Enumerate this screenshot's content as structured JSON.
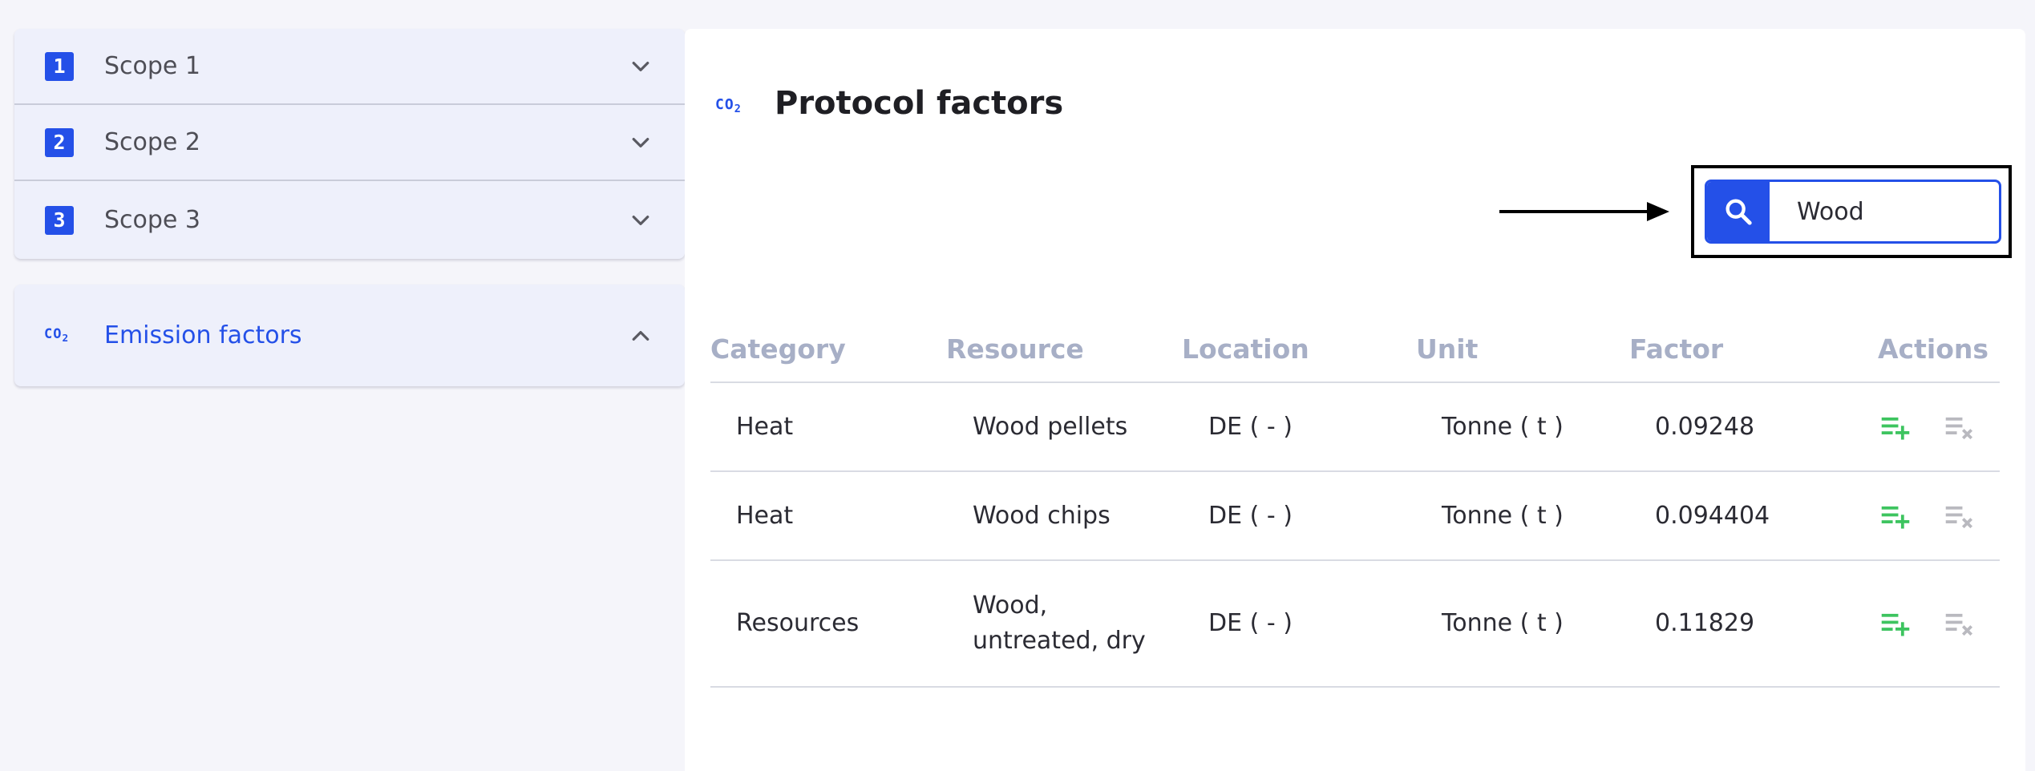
{
  "sidebar": {
    "scopes": [
      {
        "badge": "1",
        "label": "Scope 1"
      },
      {
        "badge": "2",
        "label": "Scope 2"
      },
      {
        "badge": "3",
        "label": "Scope 3"
      }
    ],
    "emission": {
      "icon_text": "CO",
      "icon_sub": "2",
      "label": "Emission factors"
    }
  },
  "main": {
    "icon_text": "CO",
    "icon_sub": "2",
    "title": "Protocol factors",
    "search": {
      "value": "Wood"
    }
  },
  "table": {
    "headers": [
      "Category",
      "Resource",
      "Location",
      "Unit",
      "Factor",
      "Actions"
    ],
    "rows": [
      {
        "category": "Heat",
        "resource": "Wood pellets",
        "location": "DE ( - )",
        "unit": "Tonne ( t )",
        "factor": "0.09248"
      },
      {
        "category": "Heat",
        "resource": "Wood chips",
        "location": "DE ( - )",
        "unit": "Tonne ( t )",
        "factor": "0.094404"
      },
      {
        "category": "Resources",
        "resource_line1": "Wood,",
        "resource_line2": "untreated, dry",
        "location": "DE ( - )",
        "unit": "Tonne ( t )",
        "factor": "0.11829"
      }
    ]
  },
  "colors": {
    "accent": "#2450e8",
    "add": "#3dc45f",
    "remove": "#b9b9bf",
    "header_text": "#a7afc6"
  },
  "icons": {
    "search": "search-icon",
    "chevron_down": "chevron-down-icon",
    "chevron_up": "chevron-up-icon",
    "add": "playlist-add-icon",
    "remove": "playlist-remove-icon",
    "annotation": "arrow-right-icon"
  }
}
